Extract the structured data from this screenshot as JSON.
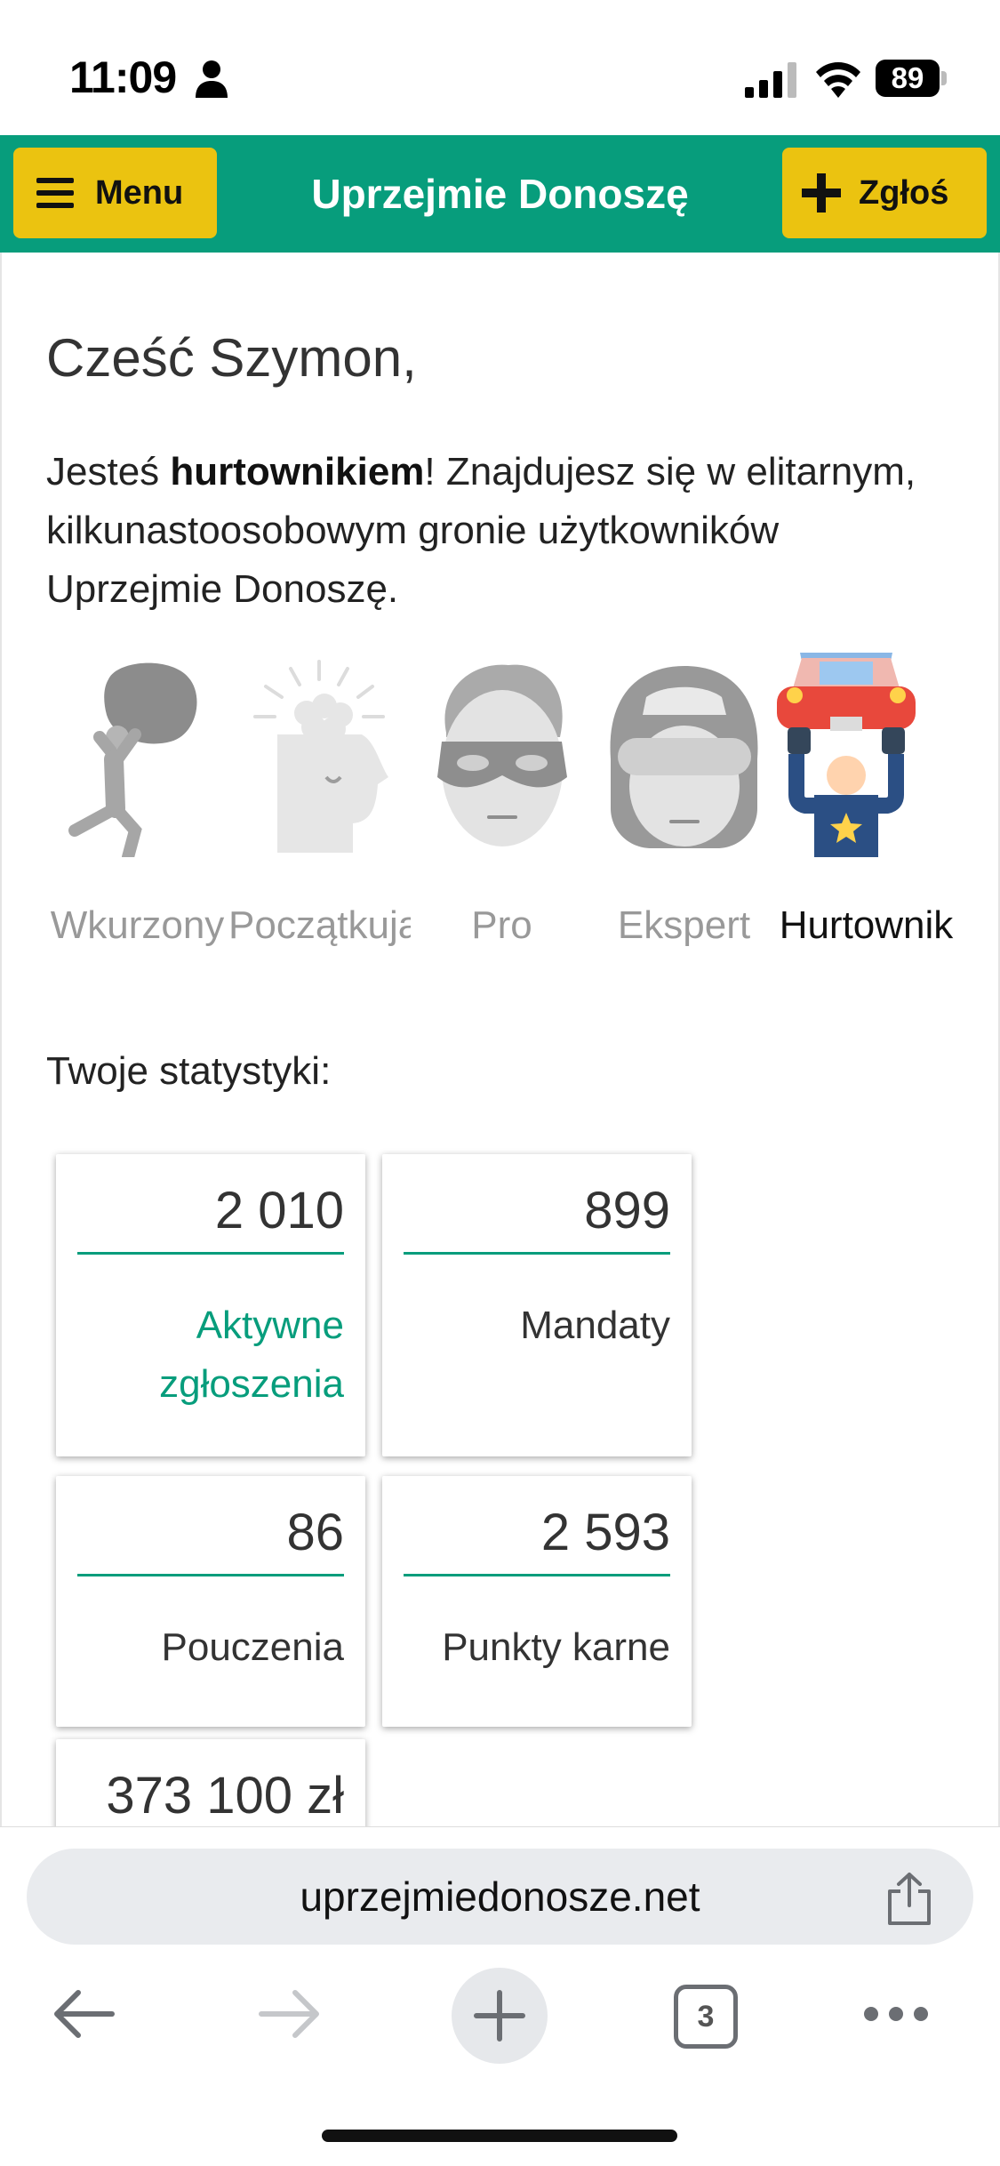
{
  "status_bar": {
    "time": "11:09",
    "battery": "89"
  },
  "header": {
    "menu_label": "Menu",
    "title": "Uprzejmie Donoszę",
    "report_label": "Zgłoś"
  },
  "main": {
    "greeting": "Cześć Szymon,",
    "intro_before": "Jesteś ",
    "intro_bold": "hurtownikiem",
    "intro_after": "! Znajdujesz się w elitarnym, kilkunastoosobowym gronie użytkowników Uprzejmie Donoszę.",
    "levels": [
      {
        "label": "Wkurzony",
        "icon": "angry-boulder-icon",
        "active": false
      },
      {
        "label": "Początkujący",
        "icon": "beginner-head-icon",
        "active": false
      },
      {
        "label": "Pro",
        "icon": "masked-hero-icon",
        "active": false
      },
      {
        "label": "Ekspert",
        "icon": "helmet-expert-icon",
        "active": false
      },
      {
        "label": "Hurtownik",
        "icon": "lifting-car-icon",
        "active": true
      }
    ],
    "stats_label": "Twoje statystyki:",
    "stats": [
      {
        "value": "2 010",
        "caption": "Aktywne zgłoszenia"
      },
      {
        "value": "899",
        "caption": "Mandaty"
      },
      {
        "value": "86",
        "caption": "Pouczenia"
      },
      {
        "value": "2 593",
        "caption": "Punkty karne"
      },
      {
        "value": "373 100 zł",
        "caption": ""
      }
    ]
  },
  "browser": {
    "url": "uprzejmiedonosze.net",
    "tab_count": "3"
  },
  "colors": {
    "brand_green": "#079d7c",
    "button_yellow": "#ebc310"
  }
}
